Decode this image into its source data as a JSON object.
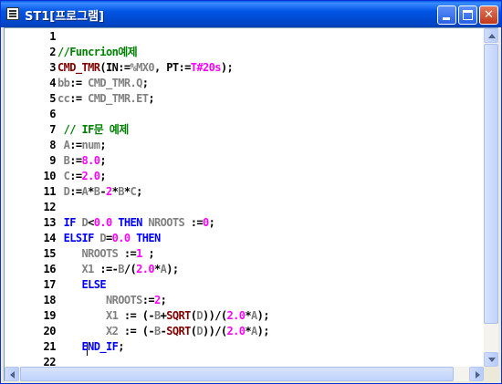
{
  "window": {
    "title": "ST1[프로그램]"
  },
  "colors": {
    "keyword": "#0000ff",
    "identifier": "#808080",
    "number": "#ff00ff",
    "operator": "#000000",
    "comment": "#008000",
    "function": "#800000"
  },
  "editor": {
    "line_numbers": [
      "1",
      "2",
      "3",
      "4",
      "5",
      "6",
      "7",
      "8",
      "9",
      "10",
      "11",
      "12",
      "13",
      "14",
      "15",
      "16",
      "17",
      "18",
      "19",
      "20",
      "21",
      "22"
    ],
    "lines": [
      [],
      [
        {
          "t": "cm",
          "s": "//Funcrion예제"
        }
      ],
      [
        {
          "t": "fn",
          "s": "CMD_TMR"
        },
        {
          "t": "op",
          "s": "(IN:="
        },
        {
          "t": "id",
          "s": "%MX0"
        },
        {
          "t": "op",
          "s": ", PT:="
        },
        {
          "t": "num",
          "s": "T#20s"
        },
        {
          "t": "op",
          "s": ");"
        }
      ],
      [
        {
          "t": "id",
          "s": "bb"
        },
        {
          "t": "op",
          "s": ":= "
        },
        {
          "t": "id",
          "s": "CMD_TMR.Q"
        },
        {
          "t": "op",
          "s": ";"
        }
      ],
      [
        {
          "t": "id",
          "s": "cc"
        },
        {
          "t": "op",
          "s": ":= "
        },
        {
          "t": "id",
          "s": "CMD_TMR.ET"
        },
        {
          "t": "op",
          "s": ";"
        }
      ],
      [],
      [
        {
          "t": "cm",
          "s": " // IF문 예제"
        }
      ],
      [
        {
          "t": "id",
          "s": " A"
        },
        {
          "t": "op",
          "s": ":="
        },
        {
          "t": "id",
          "s": "num"
        },
        {
          "t": "op",
          "s": ";"
        }
      ],
      [
        {
          "t": "id",
          "s": " B"
        },
        {
          "t": "op",
          "s": ":="
        },
        {
          "t": "num",
          "s": "8.0"
        },
        {
          "t": "op",
          "s": ";"
        }
      ],
      [
        {
          "t": "id",
          "s": " C"
        },
        {
          "t": "op",
          "s": ":="
        },
        {
          "t": "num",
          "s": "2.0"
        },
        {
          "t": "op",
          "s": ";"
        }
      ],
      [
        {
          "t": "id",
          "s": " D"
        },
        {
          "t": "op",
          "s": ":="
        },
        {
          "t": "id",
          "s": "A"
        },
        {
          "t": "op",
          "s": "*"
        },
        {
          "t": "id",
          "s": "B"
        },
        {
          "t": "op",
          "s": "-"
        },
        {
          "t": "num",
          "s": "2"
        },
        {
          "t": "op",
          "s": "*"
        },
        {
          "t": "id",
          "s": "B"
        },
        {
          "t": "op",
          "s": "*"
        },
        {
          "t": "id",
          "s": "C"
        },
        {
          "t": "op",
          "s": ";"
        }
      ],
      [],
      [
        {
          "t": "kw",
          "s": " IF "
        },
        {
          "t": "id",
          "s": "D"
        },
        {
          "t": "op",
          "s": "<"
        },
        {
          "t": "num",
          "s": "0.0"
        },
        {
          "t": "kw",
          "s": " THEN "
        },
        {
          "t": "id",
          "s": "NROOTS"
        },
        {
          "t": "op",
          "s": " :="
        },
        {
          "t": "num",
          "s": "0"
        },
        {
          "t": "op",
          "s": ";"
        }
      ],
      [
        {
          "t": "kw",
          "s": " ELSIF "
        },
        {
          "t": "id",
          "s": "D"
        },
        {
          "t": "op",
          "s": "="
        },
        {
          "t": "num",
          "s": "0.0"
        },
        {
          "t": "kw",
          "s": " THEN"
        }
      ],
      [
        {
          "t": "id",
          "s": "    NROOTS"
        },
        {
          "t": "op",
          "s": " :="
        },
        {
          "t": "num",
          "s": "1"
        },
        {
          "t": "op",
          "s": " ;"
        }
      ],
      [
        {
          "t": "id",
          "s": "    X1"
        },
        {
          "t": "op",
          "s": " :=-"
        },
        {
          "t": "id",
          "s": "B"
        },
        {
          "t": "op",
          "s": "/("
        },
        {
          "t": "num",
          "s": "2.0"
        },
        {
          "t": "op",
          "s": "*"
        },
        {
          "t": "id",
          "s": "A"
        },
        {
          "t": "op",
          "s": ");"
        }
      ],
      [
        {
          "t": "kw",
          "s": "    ELSE"
        }
      ],
      [
        {
          "t": "id",
          "s": "        NROOTS"
        },
        {
          "t": "op",
          "s": ":="
        },
        {
          "t": "num",
          "s": "2"
        },
        {
          "t": "op",
          "s": ";"
        }
      ],
      [
        {
          "t": "id",
          "s": "        X1"
        },
        {
          "t": "op",
          "s": " := (-"
        },
        {
          "t": "id",
          "s": "B"
        },
        {
          "t": "op",
          "s": "+"
        },
        {
          "t": "fn",
          "s": "SQRT"
        },
        {
          "t": "op",
          "s": "("
        },
        {
          "t": "id",
          "s": "D"
        },
        {
          "t": "op",
          "s": "))/("
        },
        {
          "t": "num",
          "s": "2.0"
        },
        {
          "t": "op",
          "s": "*"
        },
        {
          "t": "id",
          "s": "A"
        },
        {
          "t": "op",
          "s": ");"
        }
      ],
      [
        {
          "t": "id",
          "s": "        X2"
        },
        {
          "t": "op",
          "s": " := (-"
        },
        {
          "t": "id",
          "s": "B"
        },
        {
          "t": "op",
          "s": "-"
        },
        {
          "t": "fn",
          "s": "SQRT"
        },
        {
          "t": "op",
          "s": "("
        },
        {
          "t": "id",
          "s": "D"
        },
        {
          "t": "op",
          "s": "))/("
        },
        {
          "t": "num",
          "s": "2.0"
        },
        {
          "t": "op",
          "s": "*"
        },
        {
          "t": "id",
          "s": "A"
        },
        {
          "t": "op",
          "s": ");"
        }
      ],
      [
        {
          "t": "kw",
          "s": "    END_IF"
        },
        {
          "t": "op",
          "s": ";"
        }
      ],
      []
    ]
  }
}
